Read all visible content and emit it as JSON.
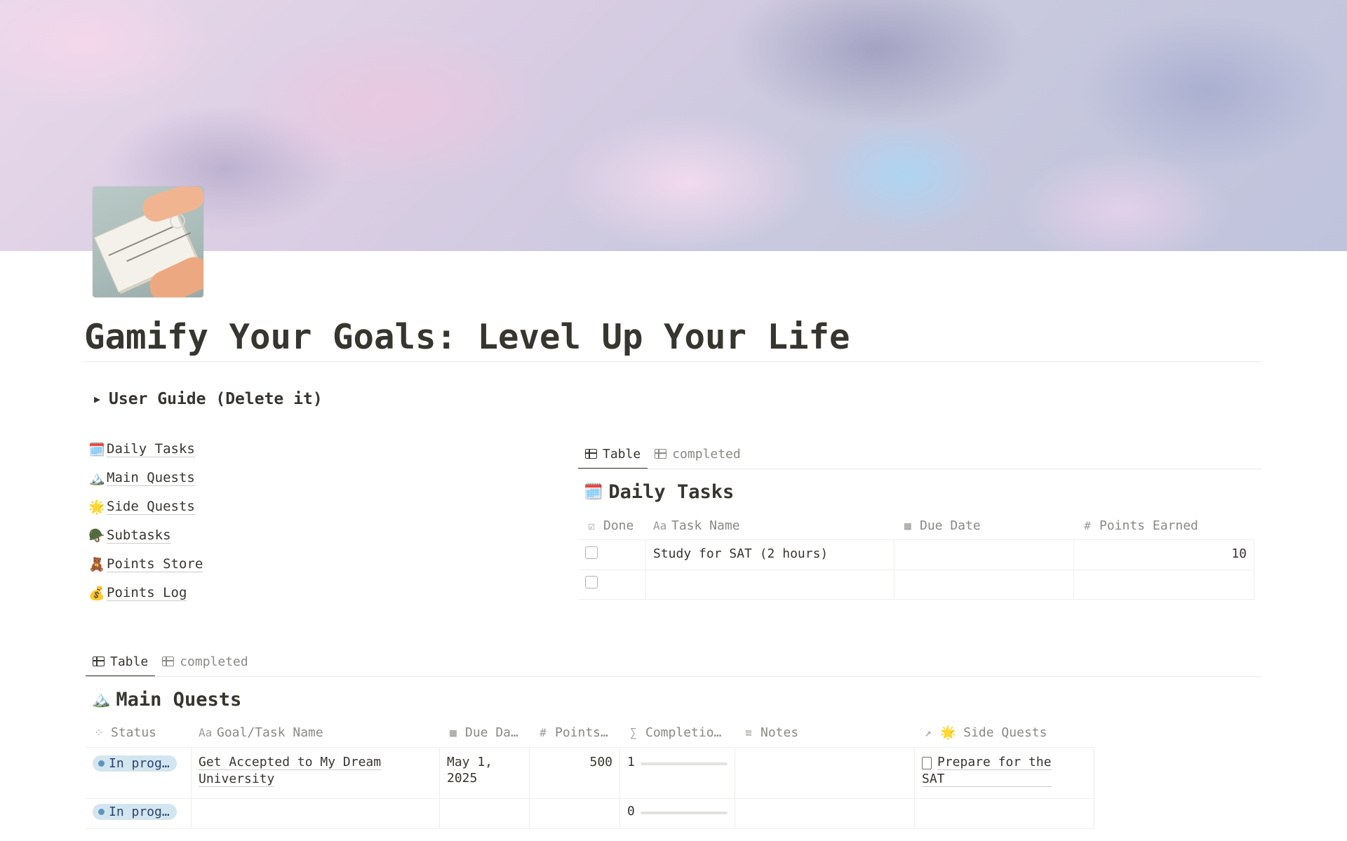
{
  "page": {
    "title": "Gamify Your Goals: Level Up Your Life",
    "toggle": {
      "arrow": "▶",
      "label": "User Guide (Delete it)"
    }
  },
  "links": [
    {
      "emoji": "🗓️",
      "label": "Daily Tasks"
    },
    {
      "emoji": "🏔️",
      "label": "Main Quests"
    },
    {
      "emoji": "🌟",
      "label": "Side Quests"
    },
    {
      "emoji": "🪖",
      "label": "Subtasks"
    },
    {
      "emoji": "🧸",
      "label": "Points Store"
    },
    {
      "emoji": "💰",
      "label": "Points Log"
    }
  ],
  "daily": {
    "tabs": [
      "Table",
      "completed"
    ],
    "title_emoji": "🗓️",
    "title": "Daily Tasks",
    "columns": [
      {
        "icon": "☑",
        "label": "Done"
      },
      {
        "icon": "Aa",
        "label": "Task Name"
      },
      {
        "icon": "▦",
        "label": "Due Date"
      },
      {
        "icon": "#",
        "label": "Points Earned"
      }
    ],
    "rows": [
      {
        "done": false,
        "task": "Study for SAT (2 hours)",
        "due": "",
        "points": "10"
      },
      {
        "done": false,
        "task": "",
        "due": "",
        "points": ""
      }
    ]
  },
  "main": {
    "tabs": [
      "Table",
      "completed"
    ],
    "title_emoji": "🏔️",
    "title": "Main Quests",
    "columns": [
      {
        "icon": "⁘",
        "label": "Status"
      },
      {
        "icon": "Aa",
        "label": "Goal/Task Name"
      },
      {
        "icon": "▦",
        "label": "Due Da…"
      },
      {
        "icon": "#",
        "label": "Points…"
      },
      {
        "icon": "∑",
        "label": "Completio…"
      },
      {
        "icon": "≡",
        "label": "Notes"
      },
      {
        "icon": "↗",
        "label": "🌟 Side Quests"
      }
    ],
    "rows": [
      {
        "status": "In prog…",
        "name_line1": "Get Accepted to My Dream",
        "name_line2": "University",
        "due_line1": "May 1,",
        "due_line2": "2025",
        "points": "500",
        "completion": "1",
        "completion_fraction": 0,
        "notes": "",
        "side_line1": "Prepare for the",
        "side_line2": "SAT"
      },
      {
        "status": "In prog…",
        "name_line1": "",
        "name_line2": "",
        "due_line1": "",
        "due_line2": "",
        "points": "",
        "completion": "0",
        "completion_fraction": 0,
        "notes": "",
        "side_line1": "",
        "side_line2": ""
      }
    ]
  },
  "colors": {
    "status_pill_bg": "#d3e5ef",
    "status_dot": "#5b97bd",
    "text": "#37352f",
    "muted": "#8a8984"
  }
}
